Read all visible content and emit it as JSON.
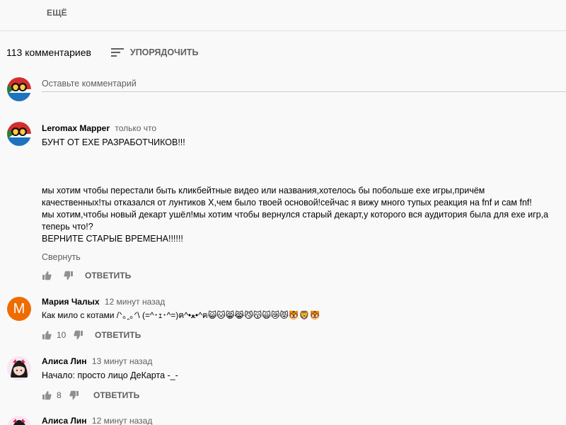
{
  "top": {
    "more_label": "ЕЩЁ"
  },
  "comments_header": {
    "count_label": "113 комментариев",
    "sort_label": "УПОРЯДОЧИТЬ"
  },
  "add_comment": {
    "placeholder": "Оставьте комментарий"
  },
  "comments": [
    {
      "author": "Leromax Mapper",
      "time": "только что",
      "text": "БУНТ ОТ EXE РАЗРАБОТЧИКОВ!!!\n\n\n\nмы хотим чтобы перестали быть кликбейтные видео или названия,хотелось бы побольше exe игры,причём\nкачественных!ты отказался от лунтиков X,чем было твоей основой!сейчас я вижу много тупых реакция на fnf и сам fnf!\nмы хотим,чтобы новый декарт ушёл!мы хотим чтобы вернулся старый декарт,у которого вся аудитория была для exe игр,а\nтеперь что!?\nВЕРНИТЕ СТАРЫЕ ВРЕМЕНА!!!!!!",
      "collapse_label": "Свернуть",
      "likes": "",
      "reply_label": "ОТВЕТИТЬ"
    },
    {
      "author": "Мария Чалых",
      "time": "12 минут назад",
      "avatar_letter": "М",
      "avatar_color": "#ef6c00",
      "text": "Как мило с котами /ᐠ｡ꞈ｡ᐟ\\ (=^･ｪ･^=)ฅ^•ﻌ•^ฅ😺🐱😸😹😼😽🙀😿😾🐯🦁🐯",
      "likes": "10",
      "reply_label": "ОТВЕТИТЬ"
    },
    {
      "author": "Алиса Лин",
      "time": "13 минут назад",
      "text": "Начало: просто лицо ДеКарта -_-",
      "likes": "8",
      "reply_label": "ОТВЕТИТЬ"
    },
    {
      "author": "Алиса Лин",
      "time": "12 минут назад"
    }
  ],
  "colors": {
    "secondary_text": "#606060",
    "divider": "#e0e0e0",
    "avatar_orange": "#ef6c00"
  },
  "icons": [
    "sort-icon",
    "thumbs-up-icon",
    "thumbs-down-icon",
    "user-avatar-flag-icon",
    "user-avatar-anime-icon"
  ]
}
